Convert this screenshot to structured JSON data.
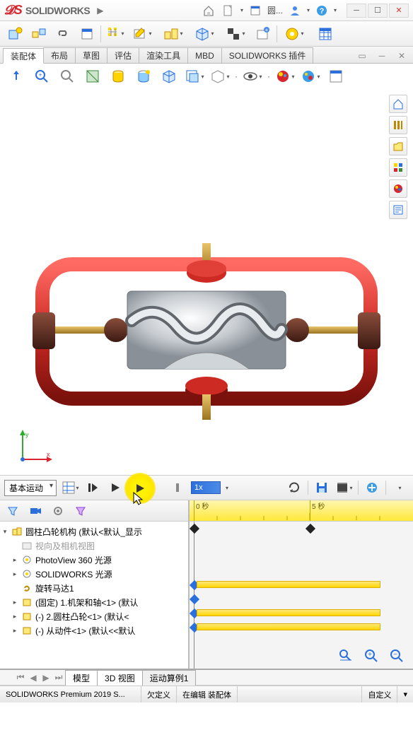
{
  "app": {
    "name": "SOLIDWORKS"
  },
  "titlebar": {
    "filename": "圆..."
  },
  "tabs": {
    "items": [
      "装配体",
      "布局",
      "草图",
      "评估",
      "渲染工具",
      "MBD",
      "SOLIDWORKS 插件"
    ],
    "active_index": 0
  },
  "motion": {
    "type_label": "基本运动",
    "time_value": "1x",
    "ruler": {
      "0": "0 秒",
      "5": "5 秒"
    }
  },
  "tree": {
    "root": {
      "label": "圆柱凸轮机构 (默认<默认_显示"
    },
    "view_folder": "视向及相机视图",
    "photoview": "PhotoView 360 光源",
    "sw_light": "SOLIDWORKS 光源",
    "motor": "旋转马达1",
    "part1": "(固定) 1.机架和轴<1> (默认",
    "part2": "(-) 2.圆柱凸轮<1> (默认<",
    "part3": "(-) 从动件<1> (默认<<默认"
  },
  "bottom_tabs": {
    "items": [
      "模型",
      "3D 视图",
      "运动算例1"
    ],
    "active_index": 2
  },
  "status": {
    "app_version": "SOLIDWORKS Premium 2019 S...",
    "underdefined": "欠定义",
    "editing": "在编辑 装配体",
    "custom": "自定义"
  },
  "colors": {
    "accent_red": "#d9262e",
    "highlight": "#fff200"
  }
}
